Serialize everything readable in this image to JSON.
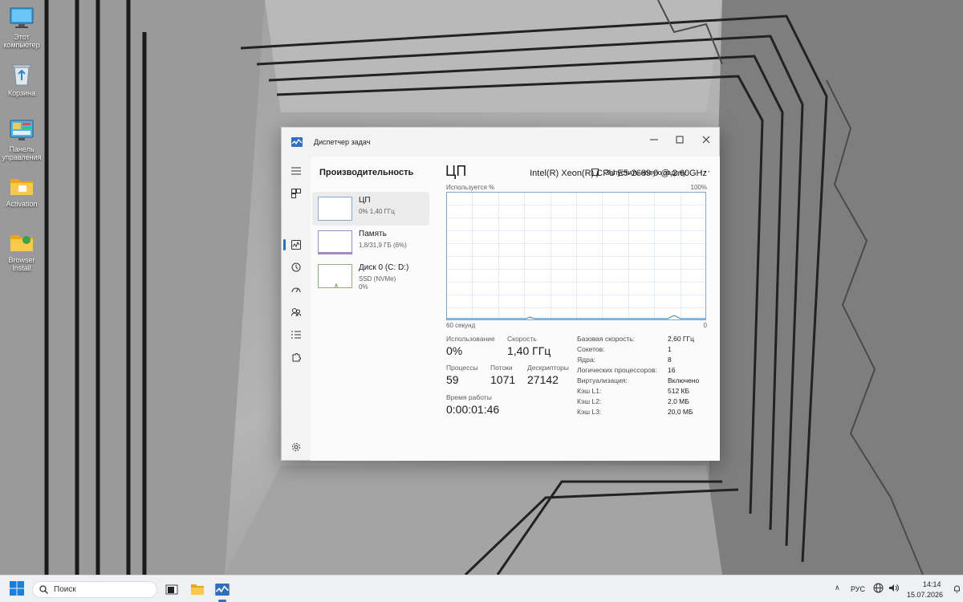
{
  "desktop": {
    "icons": [
      {
        "label": "Этот компьютер",
        "icon": "monitor-icon"
      },
      {
        "label": "Корзина",
        "icon": "recycle-bin-icon"
      },
      {
        "label": "Панель управления",
        "icon": "control-panel-icon"
      },
      {
        "label": "Activation",
        "icon": "folder-icon"
      },
      {
        "label": "Browser Install",
        "icon": "folder-icon"
      }
    ]
  },
  "window": {
    "title": "Диспетчер задач",
    "page_title": "Производительность",
    "run_task_label": "Запустить новую задачу",
    "more_label": "···"
  },
  "perf_list": [
    {
      "name": "ЦП",
      "sub": "0% 1,40 ГГц",
      "selected": true
    },
    {
      "name": "Память",
      "sub": "1,8/31,9 ГБ (6%)",
      "selected": false
    },
    {
      "name": "Диск 0 (C: D:)",
      "sub": "SSD (NVMe)",
      "sub2": "0%",
      "selected": false
    }
  ],
  "cpu": {
    "title": "ЦП",
    "model": "Intel(R) Xeon(R) CPU E5-2689 0 @ 2.60GHz",
    "graph_top_left": "Используется %",
    "graph_top_right": "100%",
    "graph_bottom_left": "60 секунд",
    "graph_bottom_right": "0",
    "stats": {
      "usage_label": "Использование",
      "usage_value": "0%",
      "speed_label": "Скорость",
      "speed_value": "1,40 ГГц",
      "processes_label": "Процессы",
      "processes_value": "59",
      "threads_label": "Потоки",
      "threads_value": "1071",
      "handles_label": "Дескрипторы",
      "handles_value": "27142",
      "uptime_label": "Время работы",
      "uptime_value": "0:00:01:46"
    },
    "specs": [
      {
        "label": "Базовая скорость:",
        "value": "2,60 ГГц"
      },
      {
        "label": "Сокетов:",
        "value": "1"
      },
      {
        "label": "Ядра:",
        "value": "8"
      },
      {
        "label": "Логических процессоров:",
        "value": "16"
      },
      {
        "label": "Виртуализация:",
        "value": "Включено"
      },
      {
        "label": "Кэш L1:",
        "value": "512 КБ"
      },
      {
        "label": "Кэш L2:",
        "value": "2,0 МБ"
      },
      {
        "label": "Кэш L3:",
        "value": "20,0 МБ"
      }
    ]
  },
  "taskbar": {
    "search_placeholder": "Поиск",
    "language": "РУС",
    "time": "14:14",
    "date": "15.07.2026"
  },
  "colors": {
    "accent": "#2f6fbe",
    "graph_line": "#4a90c8"
  }
}
